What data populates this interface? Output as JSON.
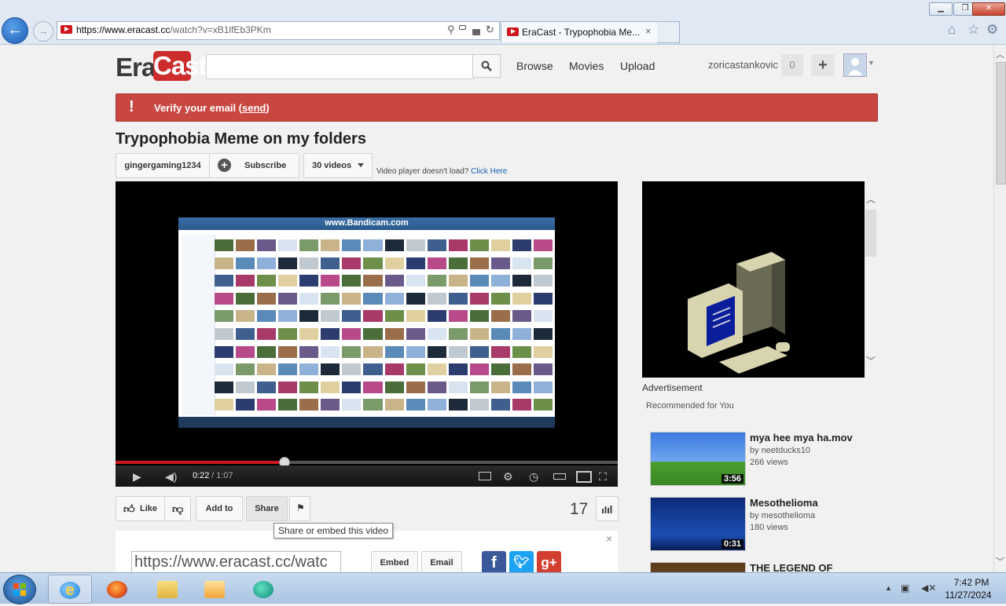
{
  "browser": {
    "url_domain": "https://www.eracast.cc",
    "url_rest": "/watch?v=xB1lfEb3PKm",
    "tab_title": "EraCast - Trypophobia Me...",
    "tab_close": "×",
    "window_min": "▁",
    "window_max": "❐",
    "window_close": "✕"
  },
  "site": {
    "logo_era": "Era",
    "logo_cast": "Cast",
    "search_placeholder": "",
    "nav": [
      "Browse",
      "Movies",
      "Upload"
    ],
    "username": "zoricastankovic",
    "notification_count": "0",
    "add_label": "+"
  },
  "banner": {
    "icon": "!",
    "text": "Verify your email (",
    "link": "send",
    "text_end": ")"
  },
  "video": {
    "title": "Trypophobia Meme on my folders",
    "channel": "gingergaming1234",
    "subscribe_label": "Subscribe",
    "videos_label": "30 videos",
    "player_note": "Video player doesn't load?",
    "player_note_link": "Click Here",
    "watermark": "www.Bandicam.com",
    "time_current": "0:22",
    "time_total": "/ 1:07",
    "progress": 0.335,
    "like_label": "Like",
    "addto_label": "Add to",
    "share_label": "Share",
    "view_count": "17",
    "tooltip": "Share or embed this video"
  },
  "share": {
    "url": "https://www.eracast.cc/watc",
    "embed_label": "Embed",
    "email_label": "Email",
    "close": "×"
  },
  "sidebar": {
    "ad_label": "Advertisement",
    "recommended_title": "Recommended for You",
    "items": [
      {
        "title": "mya hee mya ha.mov",
        "by": "by neetducks10",
        "views": "266 views",
        "duration": "3:56"
      },
      {
        "title": "Mesothelioma",
        "by": "by mesothelioma",
        "views": "180 views",
        "duration": "0:31"
      },
      {
        "title": "THE LEGEND OF",
        "by": "",
        "views": "",
        "duration": ""
      }
    ]
  },
  "taskbar": {
    "time": "7:42 PM",
    "date": "11/27/2024"
  },
  "colors": {
    "brand_red": "#cc2c2c",
    "banner_red": "#c94741",
    "progress_red": "#cc181e"
  }
}
